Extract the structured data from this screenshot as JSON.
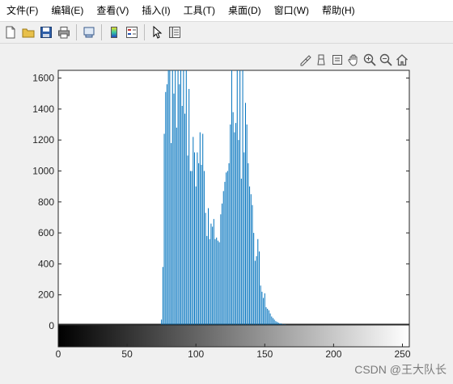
{
  "menubar": {
    "items": [
      "文件(F)",
      "编辑(E)",
      "查看(V)",
      "插入(I)",
      "工具(T)",
      "桌面(D)",
      "窗口(W)",
      "帮助(H)"
    ]
  },
  "toolbar": {
    "buttons": [
      "new-file-icon",
      "open-folder-icon",
      "save-icon",
      "print-icon",
      "link-plot-icon",
      "colorbar-icon",
      "legend-icon",
      "pointer-icon",
      "property-editor-icon"
    ]
  },
  "axes_toolbar": {
    "buttons": [
      "brush-icon",
      "data-tips-icon",
      "save-axes-icon",
      "pan-hand-icon",
      "zoom-in-icon",
      "zoom-out-icon",
      "home-icon"
    ]
  },
  "watermark": "CSDN @王大队长",
  "colors": {
    "bar": "#0072bd",
    "axes_bg": "#ffffff",
    "figure_bg": "#f0f0f0"
  },
  "chart_data": {
    "type": "bar",
    "title": "",
    "xlabel": "",
    "ylabel": "",
    "xlim": [
      0,
      255
    ],
    "ylim": [
      0,
      1650
    ],
    "xticks": [
      0,
      50,
      100,
      150,
      200,
      250
    ],
    "yticks": [
      0,
      200,
      400,
      600,
      800,
      1000,
      1200,
      1400,
      1600
    ],
    "colorbar": "grayscale 0-255 below axis",
    "x": [
      75,
      76,
      77,
      78,
      79,
      80,
      81,
      82,
      83,
      84,
      85,
      86,
      87,
      88,
      89,
      90,
      91,
      92,
      93,
      94,
      95,
      96,
      97,
      98,
      99,
      100,
      101,
      102,
      103,
      104,
      105,
      106,
      107,
      108,
      109,
      110,
      111,
      112,
      113,
      114,
      115,
      116,
      117,
      118,
      119,
      120,
      121,
      122,
      123,
      124,
      125,
      126,
      127,
      128,
      129,
      130,
      131,
      132,
      133,
      134,
      135,
      136,
      137,
      138,
      139,
      140,
      141,
      142,
      143,
      144,
      145,
      146,
      147,
      148,
      149,
      150,
      151,
      152,
      153,
      154,
      155,
      156,
      157,
      158,
      159,
      160,
      161,
      162,
      163,
      164,
      165,
      166,
      167,
      168,
      169,
      170,
      172,
      174,
      176,
      178,
      180,
      182,
      185,
      188,
      191,
      195,
      200,
      205,
      210,
      215,
      220,
      230,
      240
    ],
    "values": [
      40,
      380,
      1240,
      1510,
      1560,
      1650,
      1650,
      1180,
      1650,
      1500,
      1650,
      1280,
      1650,
      1560,
      1650,
      1420,
      1650,
      1370,
      1650,
      1100,
      1530,
      1000,
      1000,
      1220,
      1120,
      900,
      1120,
      1050,
      1250,
      1040,
      1240,
      1000,
      730,
      580,
      760,
      560,
      660,
      640,
      690,
      560,
      570,
      550,
      540,
      720,
      790,
      870,
      930,
      990,
      1000,
      1050,
      1300,
      1650,
      1380,
      1250,
      1310,
      1650,
      1200,
      1650,
      950,
      1650,
      1120,
      1440,
      1300,
      1050,
      900,
      850,
      780,
      600,
      420,
      450,
      560,
      480,
      260,
      220,
      180,
      210,
      120,
      110,
      100,
      80,
      60,
      50,
      40,
      30,
      25,
      20,
      15,
      15,
      10,
      10,
      10,
      8,
      8,
      6,
      6,
      5,
      5,
      5,
      4,
      4,
      3,
      3,
      3,
      2,
      2,
      2,
      2,
      1,
      1,
      1,
      1,
      1,
      1
    ]
  }
}
